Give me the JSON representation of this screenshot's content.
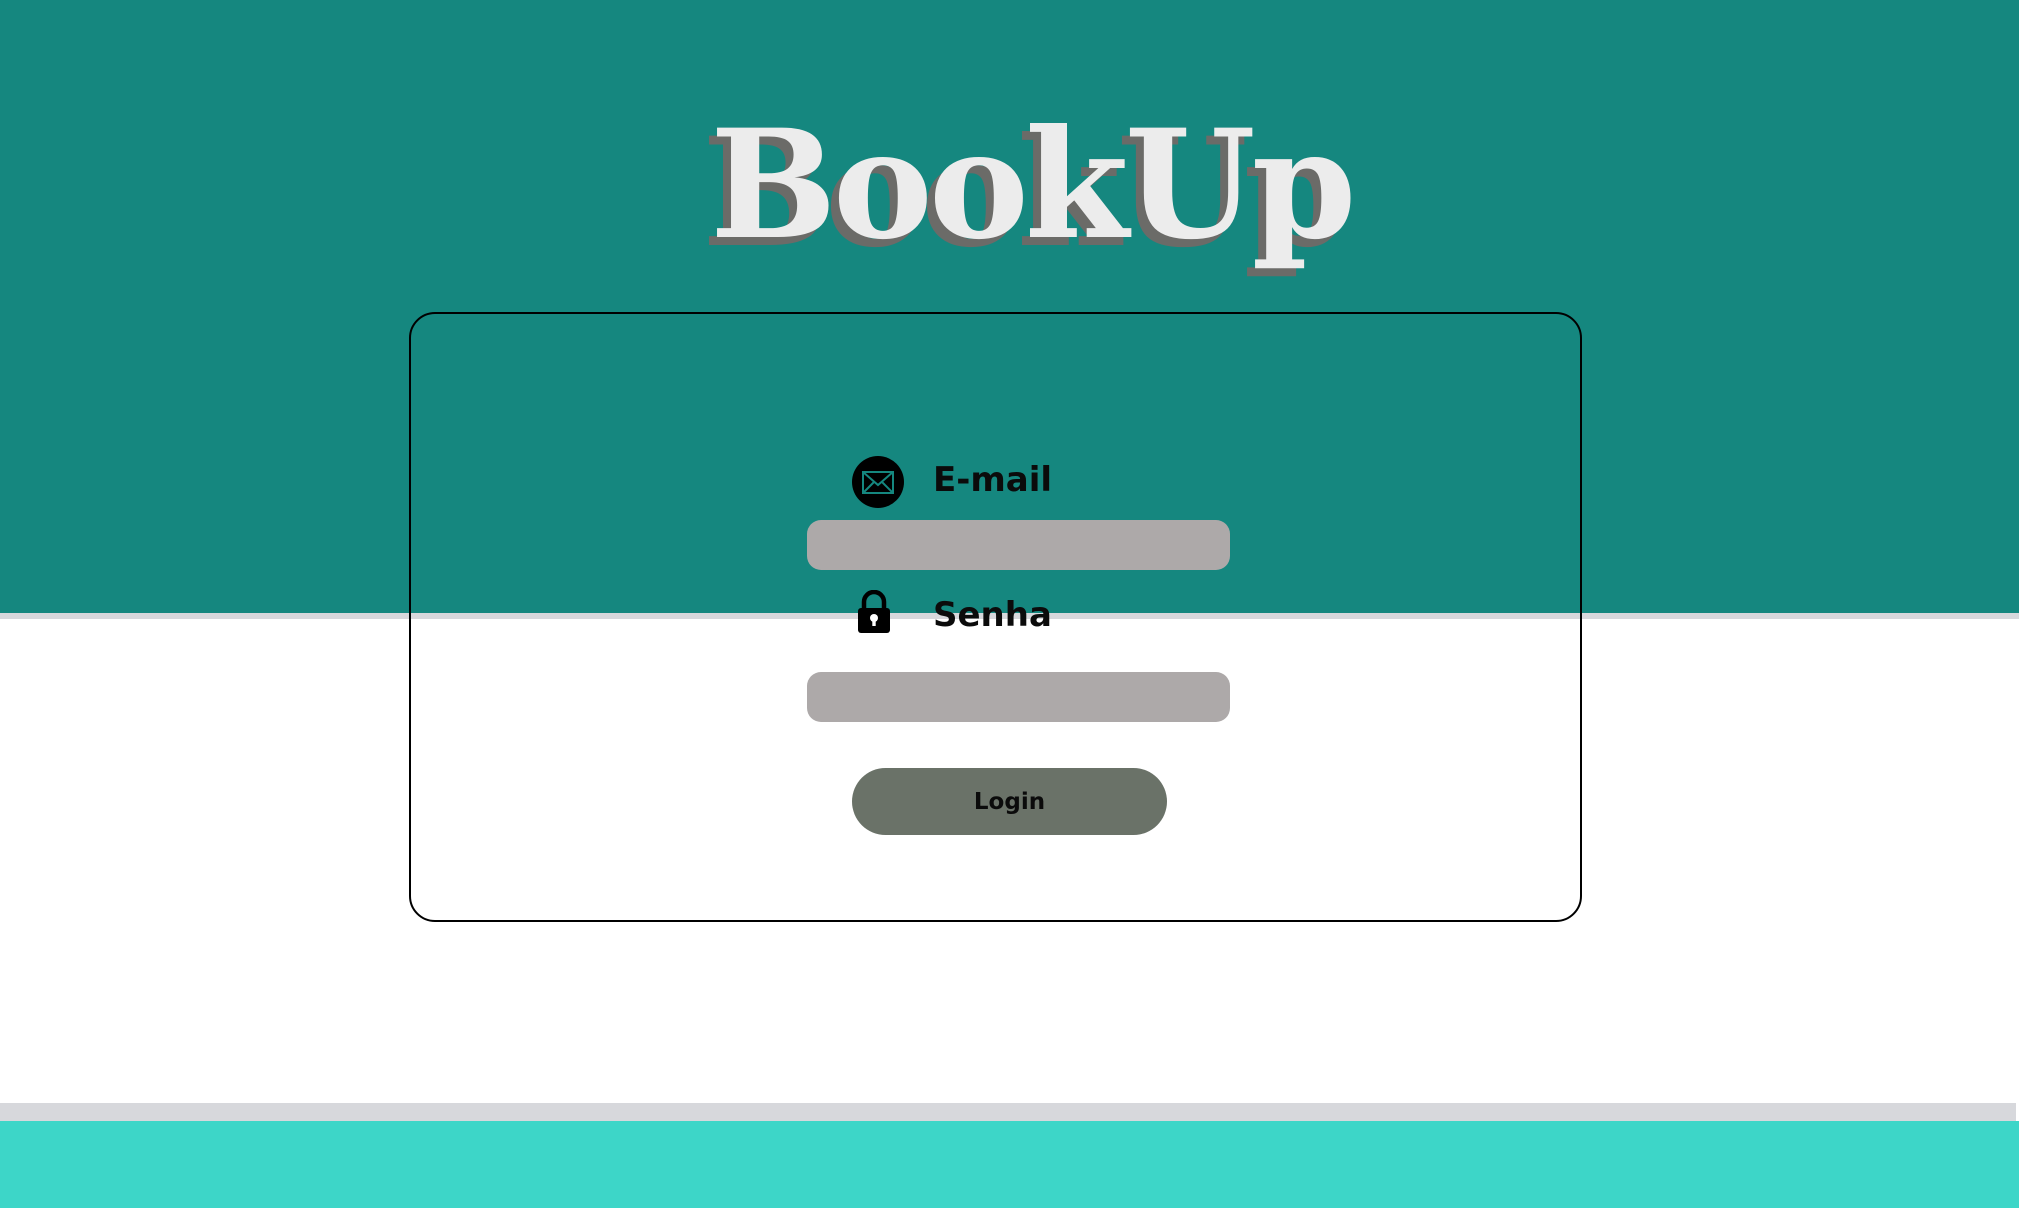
{
  "brand": {
    "name": "BookUp"
  },
  "colors": {
    "header_band": "#15877F",
    "footer_band": "#3DD6C8",
    "input_fill": "#ADA9A9",
    "button_fill": "#6A7268",
    "logo_fill": "#ECECEC",
    "logo_shadow": "#6B6B68"
  },
  "login_form": {
    "email": {
      "icon": "envelope-icon",
      "label": "E-mail",
      "value": "",
      "placeholder": ""
    },
    "password": {
      "icon": "lock-icon",
      "label": "Senha",
      "value": "",
      "placeholder": ""
    },
    "submit_label": "Login"
  }
}
